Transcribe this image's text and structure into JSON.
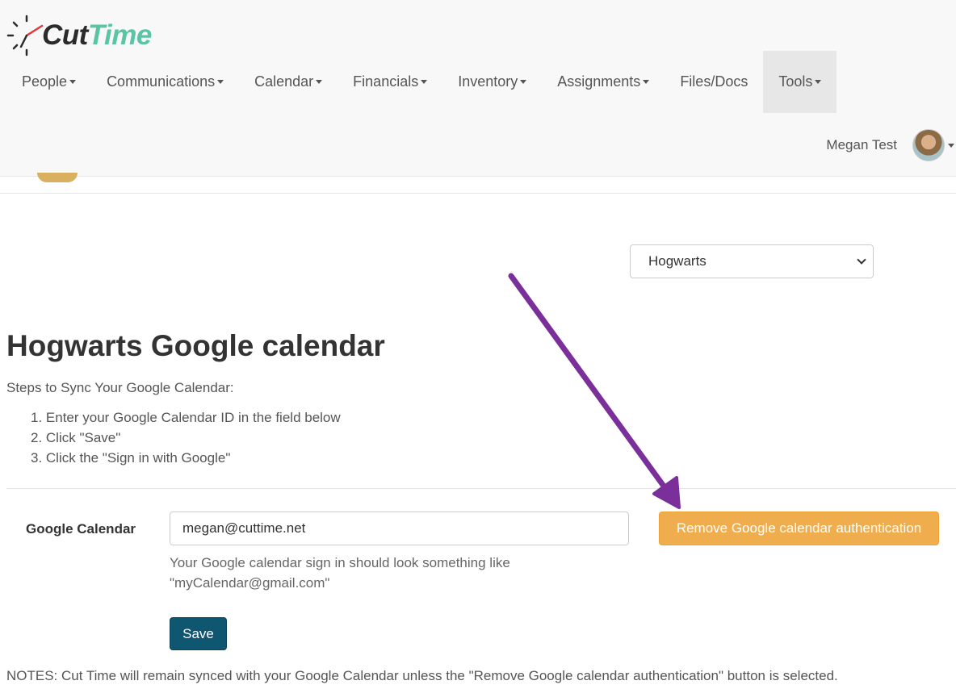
{
  "brand": {
    "name_part1": "Cut",
    "name_part2": "Time",
    "accent": "#5bc4a5"
  },
  "nav": {
    "items": [
      {
        "label": "People",
        "dropdown": true
      },
      {
        "label": "Communications",
        "dropdown": true
      },
      {
        "label": "Calendar",
        "dropdown": true
      },
      {
        "label": "Financials",
        "dropdown": true
      },
      {
        "label": "Inventory",
        "dropdown": true
      },
      {
        "label": "Assignments",
        "dropdown": true
      },
      {
        "label": "Files/Docs",
        "dropdown": false
      },
      {
        "label": "Tools",
        "dropdown": true,
        "active": true
      }
    ]
  },
  "user": {
    "name": "Megan Test"
  },
  "school_select": {
    "value": "Hogwarts"
  },
  "page": {
    "title": "Hogwarts Google calendar",
    "steps_intro": "Steps to Sync Your Google Calendar:",
    "steps": [
      "1. Enter your Google Calendar ID in the field below",
      "2. Click \"Save\"",
      "3. Click the \"Sign in with Google\""
    ]
  },
  "form": {
    "label": "Google Calendar",
    "value": "megan@cuttime.net",
    "help_line1": "Your Google calendar sign in should look something like",
    "help_line2": "\"myCalendar@gmail.com\"",
    "remove_label": "Remove Google calendar authentication",
    "save_label": "Save"
  },
  "notes": "NOTES: Cut Time will remain synced with your Google Calendar unless the \"Remove Google calendar authentication\" button is selected.",
  "colors": {
    "warning": "#f0ad4e",
    "primary": "#0f5671",
    "annotation_arrow": "#7b2f9b"
  }
}
